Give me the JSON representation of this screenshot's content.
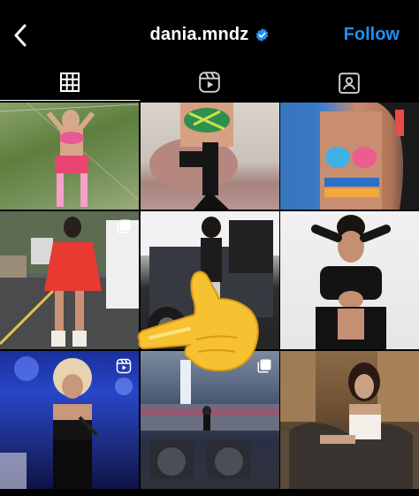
{
  "header": {
    "username": "dania.mndz",
    "follow_label": "Follow",
    "back_icon": "chevron-left-icon",
    "verified_icon": "verified-badge-icon"
  },
  "tabs": [
    {
      "name": "grid",
      "icon": "grid-icon",
      "active": true
    },
    {
      "name": "reels",
      "icon": "reels-icon",
      "active": false
    },
    {
      "name": "tagged",
      "icon": "tagged-person-icon",
      "active": false
    }
  ],
  "posts": [
    {
      "type": "photo",
      "description_icon": "none"
    },
    {
      "type": "photo",
      "description_icon": "none"
    },
    {
      "type": "photo",
      "description_icon": "none"
    },
    {
      "type": "carousel",
      "description_icon": "carousel-icon"
    },
    {
      "type": "photo",
      "description_icon": "none"
    },
    {
      "type": "photo",
      "description_icon": "none"
    },
    {
      "type": "reel",
      "description_icon": "reels-icon"
    },
    {
      "type": "carousel",
      "description_icon": "carousel-icon"
    },
    {
      "type": "photo",
      "description_icon": "none"
    }
  ],
  "overlay": {
    "icon": "pointing-hand-emoji"
  },
  "colors": {
    "background": "#000000",
    "follow": "#1f8ff5",
    "verified": "#1f8ff5"
  }
}
